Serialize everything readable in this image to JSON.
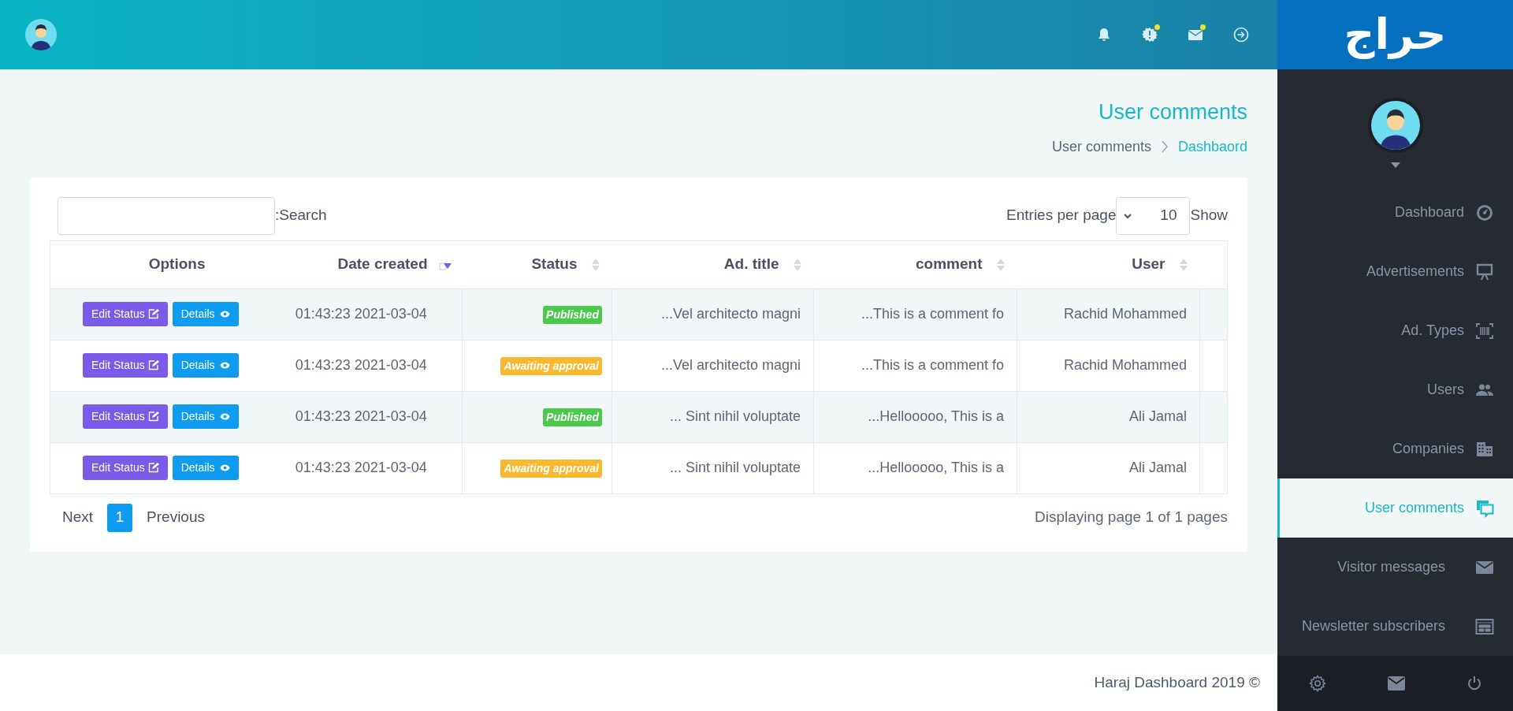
{
  "topbar": {
    "icons": [
      {
        "dot": false
      },
      {
        "dot": true
      },
      {
        "dot": true
      },
      {
        "dot": false
      }
    ]
  },
  "sidebar": {
    "logo": "حراج",
    "items": [
      {
        "label": "Dashboard",
        "selected": false
      },
      {
        "label": "Advertisements",
        "selected": false
      },
      {
        "label": "Ad. Types",
        "selected": false
      },
      {
        "label": "Users",
        "selected": false
      },
      {
        "label": "Companies",
        "selected": false
      },
      {
        "label": "User comments",
        "selected": true
      },
      {
        "label": "Visitor messages",
        "selected": false
      },
      {
        "label": "Newsletter subscribers",
        "selected": false
      }
    ]
  },
  "page": {
    "title": "User comments",
    "breadcrumb": [
      "User comments",
      "Dashbaord"
    ]
  },
  "table": {
    "search_label": ":Search",
    "entries_label": "Entries per page",
    "entries_value": "10",
    "show_label": "Show",
    "columns": [
      {
        "label": "Options",
        "sortable": false
      },
      {
        "label": "Date created",
        "sortable": true,
        "sorted": true
      },
      {
        "label": "Status",
        "sortable": true,
        "sorted": false
      },
      {
        "label": "Ad. title",
        "sortable": true,
        "sorted": false
      },
      {
        "label": "comment",
        "sortable": true,
        "sorted": false
      },
      {
        "label": "User",
        "sortable": true,
        "sorted": false
      }
    ],
    "rows": [
      {
        "edit": "Edit Status",
        "details": "Details",
        "date": "01:43:23 2021-03-04",
        "status": {
          "label": "Published",
          "kind": "published"
        },
        "ad_title": "...Vel architecto magni",
        "comment": "...This is a comment fo",
        "user": "Rachid Mohammed"
      },
      {
        "edit": "Edit Status",
        "details": "Details",
        "date": "01:43:23 2021-03-04",
        "status": {
          "label": "Awaiting approval",
          "kind": "awaiting"
        },
        "ad_title": "...Vel architecto magni",
        "comment": "...This is a comment fo",
        "user": "Rachid Mohammed"
      },
      {
        "edit": "Edit Status",
        "details": "Details",
        "date": "01:43:23 2021-03-04",
        "status": {
          "label": "Published",
          "kind": "published"
        },
        "ad_title": "... Sint nihil voluptate",
        "comment": "...Hellooooo, This is a",
        "user": "Ali Jamal"
      },
      {
        "edit": "Edit Status",
        "details": "Details",
        "date": "01:43:23 2021-03-04",
        "status": {
          "label": "Awaiting approval",
          "kind": "awaiting"
        },
        "ad_title": "... Sint nihil voluptate",
        "comment": "...Hellooooo, This is a",
        "user": "Ali Jamal"
      }
    ],
    "pagination": [
      {
        "label": "Next",
        "selected": false
      },
      {
        "label": "1",
        "selected": true
      },
      {
        "label": "Previous",
        "selected": false
      }
    ],
    "page_info": "Displaying page 1 of 1 pages"
  },
  "footer": "Haraj Dashboard 2019 ©"
}
